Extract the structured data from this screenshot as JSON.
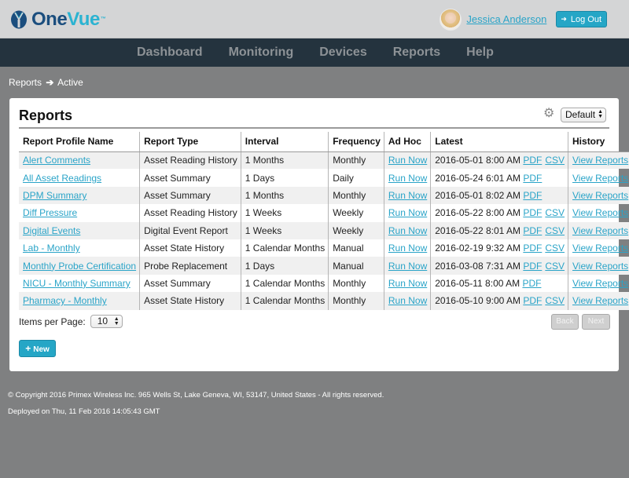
{
  "header": {
    "logo": {
      "part1": "One",
      "part2": "Vue",
      "tm": "™"
    },
    "user": {
      "name": "Jessica Anderson"
    },
    "logout_label": "Log Out"
  },
  "nav": {
    "items": [
      {
        "label": "Dashboard"
      },
      {
        "label": "Monitoring"
      },
      {
        "label": "Devices"
      },
      {
        "label": "Reports"
      },
      {
        "label": "Help"
      }
    ]
  },
  "breadcrumb": {
    "parent": "Reports",
    "separator": "➔",
    "current": "Active"
  },
  "panel": {
    "title": "Reports",
    "view_select": {
      "value": "Default"
    },
    "table": {
      "columns": [
        "Report Profile Name",
        "Report Type",
        "Interval",
        "Frequency",
        "Ad Hoc",
        "Latest",
        "History"
      ],
      "rows": [
        {
          "name": "Alert Comments",
          "type": "Asset Reading History",
          "interval": "1 Months",
          "frequency": "Monthly",
          "adhoc": "Run Now",
          "latest": "2016-05-01 8:00 AM",
          "pdf": "PDF",
          "csv": "CSV",
          "history": "View Reports"
        },
        {
          "name": "All Asset Readings",
          "type": "Asset Summary",
          "interval": "1 Days",
          "frequency": "Daily",
          "adhoc": "Run Now",
          "latest": "2016-05-24 6:01 AM",
          "pdf": "PDF",
          "csv": "",
          "history": "View Reports"
        },
        {
          "name": "DPM Summary",
          "type": "Asset Summary",
          "interval": "1 Months",
          "frequency": "Monthly",
          "adhoc": "Run Now",
          "latest": "2016-05-01 8:02 AM",
          "pdf": "PDF",
          "csv": "",
          "history": "View Reports"
        },
        {
          "name": "Diff Pressure",
          "type": "Asset Reading History",
          "interval": "1 Weeks",
          "frequency": "Weekly",
          "adhoc": "Run Now",
          "latest": "2016-05-22 8:00 AM",
          "pdf": "PDF",
          "csv": "CSV",
          "history": "View Reports"
        },
        {
          "name": "Digital Events",
          "type": "Digital Event Report",
          "interval": "1 Weeks",
          "frequency": "Weekly",
          "adhoc": "Run Now",
          "latest": "2016-05-22 8:01 AM",
          "pdf": "PDF",
          "csv": "CSV",
          "history": "View Reports"
        },
        {
          "name": "Lab - Monthly",
          "type": "Asset State History",
          "interval": "1 Calendar Months",
          "frequency": "Manual",
          "adhoc": "Run Now",
          "latest": "2016-02-19 9:32 AM",
          "pdf": "PDF",
          "csv": "CSV",
          "history": "View Reports"
        },
        {
          "name": "Monthly Probe Certification",
          "type": "Probe Replacement",
          "interval": "1 Days",
          "frequency": "Manual",
          "adhoc": "Run Now",
          "latest": "2016-03-08 7:31 AM",
          "pdf": "PDF",
          "csv": "CSV",
          "history": "View Reports"
        },
        {
          "name": "NICU - Monthly Summary",
          "type": "Asset Summary",
          "interval": "1 Calendar Months",
          "frequency": "Monthly",
          "adhoc": "Run Now",
          "latest": "2016-05-11 8:00 AM",
          "pdf": "PDF",
          "csv": "",
          "history": "View Reports"
        },
        {
          "name": "Pharmacy - Monthly",
          "type": "Asset State History",
          "interval": "1 Calendar Months",
          "frequency": "Monthly",
          "adhoc": "Run Now",
          "latest": "2016-05-10 9:00 AM",
          "pdf": "PDF",
          "csv": "CSV",
          "history": "View Reports"
        }
      ]
    },
    "items_per_page": {
      "label": "Items per Page:",
      "value": "10"
    },
    "pager": {
      "back": "Back",
      "next": "Next"
    },
    "new_label": "New"
  },
  "footer": {
    "copyright": "© Copyright 2016 Primex Wireless Inc. 965 Wells St, Lake Geneva, WI, 53147, United States - All rights reserved.",
    "deployed": "Deployed on Thu, 11 Feb 2016 14:05:43 GMT"
  },
  "colors": {
    "accent": "#25a6c6",
    "link": "#2aa4c8",
    "nav_bg": "#24333e",
    "header_bg": "#d4d5d6",
    "page_bg": "#7f8081"
  }
}
